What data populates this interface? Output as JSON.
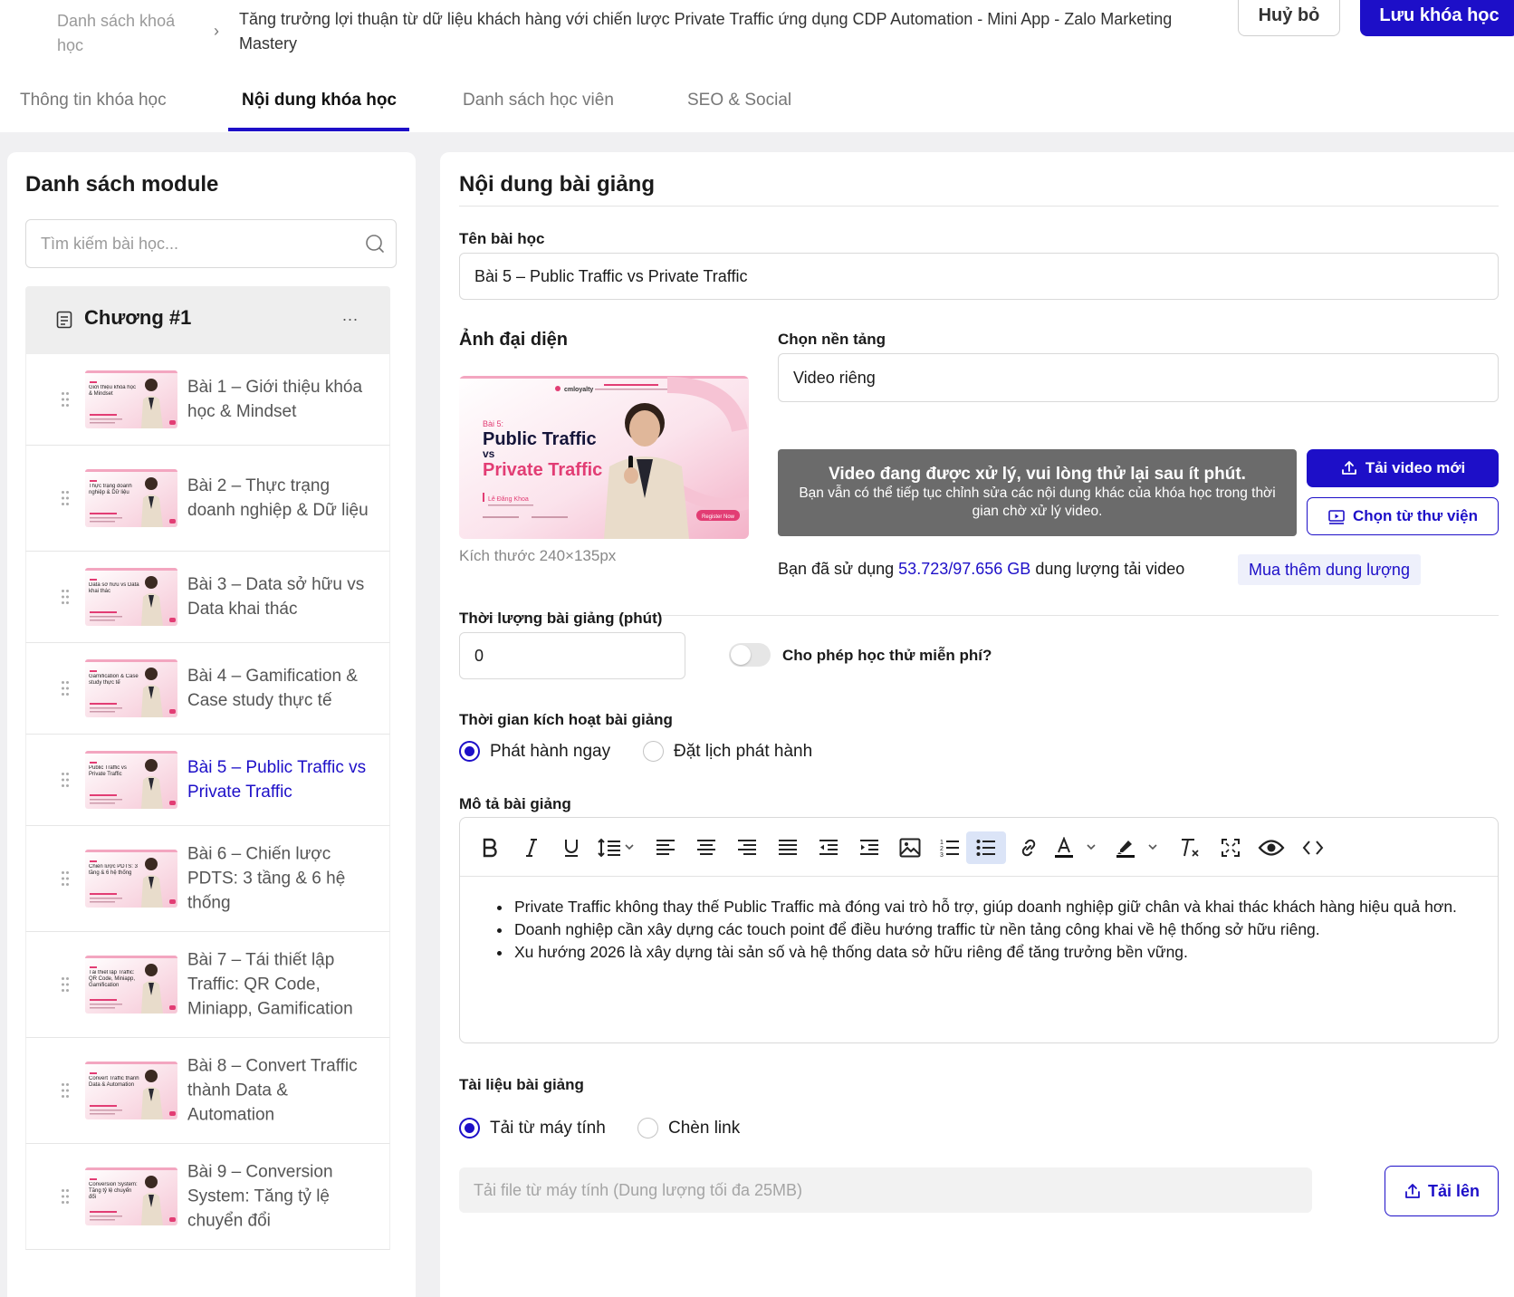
{
  "breadcrumb": {
    "parent": "Danh sách khoá học",
    "current": "Tăng trưởng lợi thuận từ dữ liệu khách hàng với chiến lược Private Traffic ứng dụng CDP Automation - Mini App - Zalo Marketing Mastery"
  },
  "actions": {
    "cancel": "Huỷ bỏ",
    "save": "Lưu khóa học"
  },
  "tabs": [
    {
      "label": "Thông tin khóa học"
    },
    {
      "label": "Nội dung khóa học"
    },
    {
      "label": "Danh sách học viên"
    },
    {
      "label": "SEO & Social"
    }
  ],
  "active_tab": "Nội dung khóa học",
  "sidebar": {
    "title": "Danh sách module",
    "search_placeholder": "Tìm kiếm bài học...",
    "chapter_title": "Chương #1",
    "chapter_menu": "...",
    "active_lesson": 5,
    "lessons": [
      {
        "label": "Bài 1 – Giới thiệu khóa học & Mindset",
        "thumb_text": "Giới thiệu khóa học & Mindset"
      },
      {
        "label": "Bài 2 – Thực trạng doanh nghiệp & Dữ liệu",
        "thumb_text": "Thực trạng doanh nghiệp & Dữ liệu"
      },
      {
        "label": "Bài 3 – Data sở hữu vs Data khai thác",
        "thumb_text": "Data sở hữu vs Data khai thác"
      },
      {
        "label": "Bài 4 – Gamification & Case study thực tế",
        "thumb_text": "Gamification & Case study thực tế"
      },
      {
        "label": "Bài 5 – Public Traffic vs Private Traffic",
        "thumb_text": "Public Traffic vs Private Traffic"
      },
      {
        "label": "Bài 6 – Chiến lược PDTS: 3 tầng & 6 hệ thống",
        "thumb_text": "Chiến lược PDTS: 3 tầng & 6 hệ thống"
      },
      {
        "label": "Bài 7 – Tái thiết lập Traffic: QR Code, Miniapp, Gamification",
        "thumb_text": "Tái thiết lập Traffic: QR Code, Miniapp, Gamification"
      },
      {
        "label": "Bài 8 – Convert Traffic thành Data & Automation",
        "thumb_text": "Convert Traffic thành Data & Automation"
      },
      {
        "label": "Bài 9 – Conversion System: Tăng tỷ lệ chuyển đổi",
        "thumb_text": "Conversion System: Tăng tỷ lệ chuyển đổi"
      }
    ]
  },
  "content": {
    "title": "Nội dung bài giảng",
    "lesson_name_label": "Tên bài học",
    "lesson_name_value": "Bài 5 – Public Traffic vs Private Traffic",
    "cover_label": "Ảnh đại diện",
    "cover": {
      "brand": "cmloyalty",
      "lesson_no": "Bài 5:",
      "line1": "Public Traffic",
      "line2": "vs",
      "line3": "Private Traffic",
      "speaker": "Lê Đăng Khoa",
      "cta": "Register Now"
    },
    "cover_size": "Kích thước 240×135px",
    "platform_label": "Chọn nền tảng",
    "platform_value": "Video riêng",
    "processing_title": "Video đang được xử lý, vui lòng thử lại sau ít phút.",
    "processing_desc": "Bạn vẫn có thể tiếp tục chỉnh sửa các nội dung khác của khóa học trong thời gian chờ xử lý video.",
    "upload_video_btn": "Tải video mới",
    "library_btn": "Chọn từ thư viện",
    "storage_prefix": "Bạn đã sử dụng",
    "storage_used": "53.723/97.656 GB",
    "storage_suffix": "dung lượng tải video",
    "buy_more": "Mua thêm dung lượng",
    "duration_label": "Thời lượng bài giảng (phút)",
    "duration_value": "0",
    "free_trial_label": "Cho phép học thử miễn phí?",
    "free_trial_on": false,
    "activation_label": "Thời gian kích hoạt bài giảng",
    "activation_options": [
      "Phát hành ngay",
      "Đặt lịch phát hành"
    ],
    "activation_selected": "Phát hành ngay",
    "description_label": "Mô tả bài giảng",
    "description_items": [
      "Private Traffic không thay thế Public Traffic mà đóng vai trò hỗ trợ, giúp doanh nghiệp giữ chân và khai thác khách hàng hiệu quả hơn.",
      "Doanh nghiệp cần xây dựng các touch point để điều hướng traffic từ nền tảng công khai về hệ thống sở hữu riêng.",
      "Xu hướng 2026 là xây dựng tài sản số và hệ thống data sở hữu riêng để tăng trưởng bền vững."
    ],
    "toolbar_icons": [
      "bold-icon",
      "italic-icon",
      "underline-icon",
      "line-height-icon",
      "align-left-icon",
      "align-center-icon",
      "align-right-icon",
      "align-justify-icon",
      "outdent-icon",
      "indent-icon",
      "image-icon",
      "ordered-list-icon",
      "bullet-list-icon",
      "link-icon",
      "font-color-icon",
      "highlight-icon",
      "clear-format-icon",
      "fullscreen-icon",
      "preview-icon",
      "code-view-icon"
    ],
    "materials_label": "Tài liệu bài giảng",
    "materials_options": [
      "Tải từ máy tính",
      "Chèn link"
    ],
    "materials_selected": "Tải từ máy tính",
    "upload_placeholder": "Tải file từ máy tính (Dung lượng tối đa 25MB)",
    "upload_btn": "Tải lên"
  },
  "colors": {
    "primary": "#1d0fc8",
    "processing_bg": "#6b6b6b",
    "active_tool_bg": "#dbe4f7"
  }
}
